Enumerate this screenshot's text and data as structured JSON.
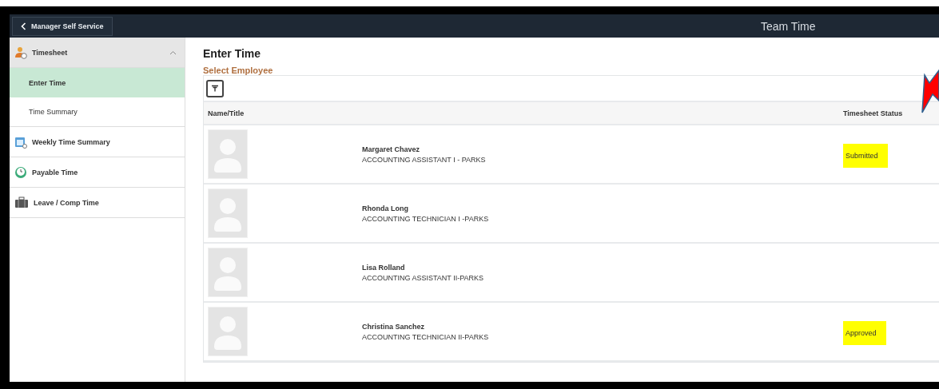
{
  "header": {
    "back_button": "Manager Self Service",
    "title": "Team Time"
  },
  "sidebar": {
    "items": [
      {
        "label": "Timesheet",
        "selected": false,
        "expanded": true,
        "children": [
          {
            "label": "Enter Time",
            "selected": true
          },
          {
            "label": "Time Summary",
            "selected": false
          }
        ]
      },
      {
        "label": "Weekly Time Summary",
        "selected": false
      },
      {
        "label": "Payable Time",
        "selected": false
      },
      {
        "label": "Leave / Comp Time",
        "selected": false
      }
    ]
  },
  "main": {
    "title": "Enter Time",
    "section": "Select Employee",
    "table": {
      "columns": [
        "Name/Title",
        "Timesheet Status"
      ],
      "rows": [
        {
          "name": "Margaret Chavez",
          "title": "ACCOUNTING ASSISTANT I - PARKS",
          "status": "Submitted",
          "highlighted": true
        },
        {
          "name": "Rhonda Long",
          "title": "ACCOUNTING TECHNICIAN I -PARKS"
        },
        {
          "name": "Lisa Rolland",
          "title": "ACCOUNTING ASSISTANT II-PARKS"
        },
        {
          "name": "Christina Sanchez",
          "title": "ACCOUNTING TECHNICIAN II-PARKS",
          "status": "Approved",
          "highlighted": true
        }
      ]
    }
  },
  "annotation": {
    "kind": "arrow"
  }
}
